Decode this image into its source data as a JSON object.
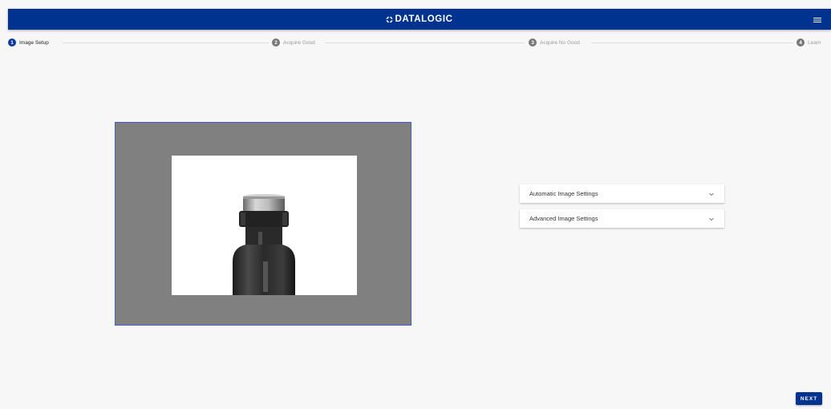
{
  "header": {
    "logo_text": "DATALOGIC",
    "logo_icon": "datalogic-logo-icon",
    "menu_icon": "hamburger-menu-icon",
    "brand_color": "#00328f"
  },
  "stepper": {
    "steps": [
      {
        "number": "1",
        "label": "Image Setup",
        "active": true
      },
      {
        "number": "2",
        "label": "Acquire Good",
        "active": false
      },
      {
        "number": "3",
        "label": "Acquire No Good",
        "active": false
      },
      {
        "number": "4",
        "label": "Learn",
        "active": false
      }
    ]
  },
  "image_view": {
    "image_subject": "glass vial with cap",
    "frame_color": "#808080",
    "roi_color": "#ffffff"
  },
  "settings": {
    "panels": [
      {
        "label": "Automatic Image Settings",
        "icon": "chevron-down-icon",
        "expanded": false
      },
      {
        "label": "Advanced Image Settings",
        "icon": "chevron-down-icon",
        "expanded": false
      }
    ]
  },
  "footer": {
    "next_label": "NEXT"
  }
}
